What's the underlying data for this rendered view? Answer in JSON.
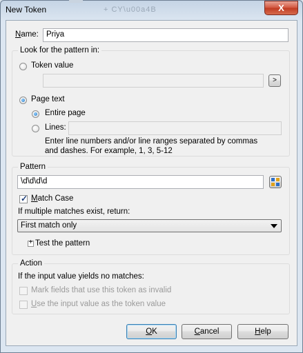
{
  "window": {
    "title": "New Token",
    "close_glyph": "X",
    "ghost_text": "+ CY\\u00a4B"
  },
  "name": {
    "label_u": "N",
    "label_rest": "ame:",
    "value": "Priya"
  },
  "look_for": {
    "title": "Look for the pattern in:",
    "token_value_label": "Token value",
    "token_value_input": "",
    "browse_glyph": ">",
    "page_text_label": "Page text",
    "entire_page_label": "Entire page",
    "lines_label": "Lines:",
    "lines_input": "",
    "hint": "Enter line numbers and/or line ranges separated by commas and dashes.  For example, 1, 3, 5-12"
  },
  "pattern": {
    "title": "Pattern",
    "value": "\\d\\d\\d\\d",
    "match_case_u": "M",
    "match_case_rest": "atch Case",
    "multiple_label": "If multiple matches exist, return:",
    "return_selected": "First match only",
    "expander_glyph": "+",
    "test_label": "Test the pattern"
  },
  "action": {
    "title": "Action",
    "no_match_label": "If the input value yields no matches:",
    "mark_invalid_label": "Mark fields that use this token as invalid",
    "use_input_u": "U",
    "use_input_rest": "se the input value as the token value"
  },
  "buttons": {
    "ok_u": "O",
    "ok_rest": "K",
    "cancel_u": "C",
    "cancel_rest": "ancel",
    "help_u": "H",
    "help_rest": "elp"
  }
}
